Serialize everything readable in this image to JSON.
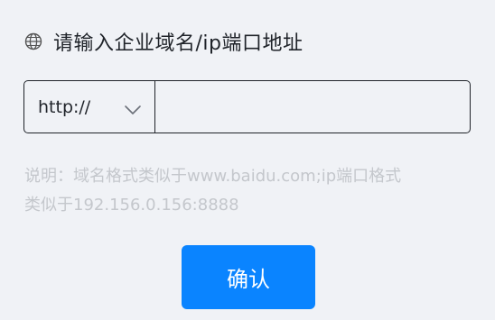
{
  "header": {
    "icon": "globe-icon",
    "title": "请输入企业域名/ip端口地址"
  },
  "form": {
    "protocol_selected": "http://",
    "domain_value": "",
    "domain_placeholder": ""
  },
  "hint": {
    "line1": "说明：域名格式类似于www.baidu.com;ip端口格式",
    "line2": "类似于192.156.0.156:8888"
  },
  "actions": {
    "confirm_label": "确认"
  },
  "colors": {
    "background": "#f0f2f6",
    "primary": "#0a84ff",
    "text": "#1f2329",
    "hint_text": "#c4c7cc"
  }
}
